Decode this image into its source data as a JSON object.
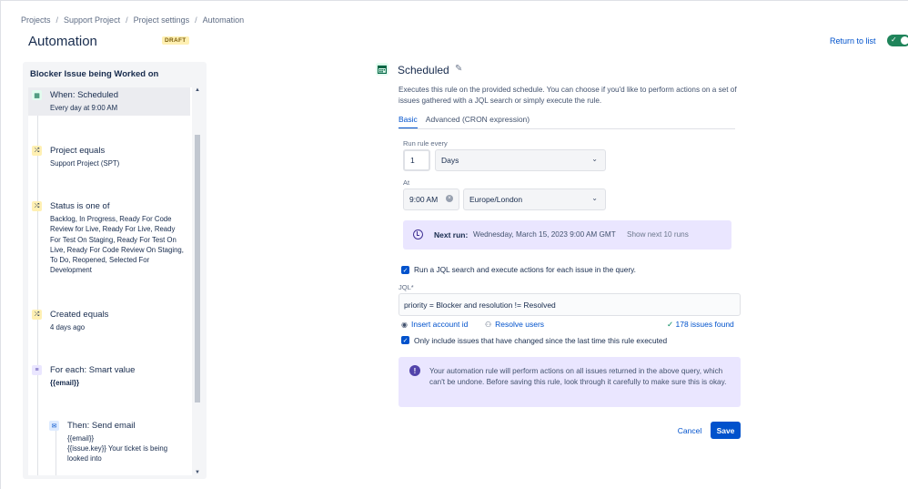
{
  "breadcrumb": {
    "items": [
      "Projects",
      "Support Project",
      "Project settings",
      "Automation"
    ]
  },
  "page": {
    "title": "Automation",
    "badge": "DRAFT",
    "return_link": "Return to list",
    "toggle_check": "✓"
  },
  "rule": {
    "name": "Blocker Issue being Worked on",
    "steps": [
      {
        "title": "When: Scheduled",
        "desc": "Every day at 9:00 AM",
        "icon": "calendar-icon"
      },
      {
        "title": "Project equals",
        "desc": "Support Project (SPT)",
        "icon": "condition-icon"
      },
      {
        "title": "Status is one of",
        "desc": "Backlog, In Progress, Ready For Code Review for Live, Ready For Live, Ready For Test On Staging, Ready For Test On Live, Ready For Code Review On Staging, To Do, Reopened, Selected For Development",
        "icon": "condition-icon"
      },
      {
        "title": "Created equals",
        "desc": "4 days ago",
        "icon": "condition-icon"
      },
      {
        "title": "For each: Smart value",
        "desc": "{{email}}",
        "icon": "branch-icon"
      },
      {
        "title": "Then: Send email",
        "desc": "{{email}}",
        "desc2": "{{issue.key}} Your ticket is being looked into",
        "icon": "email-icon"
      }
    ]
  },
  "config": {
    "title": "Scheduled",
    "description": "Executes this rule on the provided schedule. You can choose if you'd like to perform actions on a set of issues gathered with a JQL search or simply execute the rule.",
    "tabs": [
      "Basic",
      "Advanced (CRON expression)"
    ],
    "run_rule_every_label": "Run rule every",
    "interval_value": "1",
    "interval_unit": "Days",
    "at_label": "At",
    "time_value": "9:00 AM",
    "timezone": "Europe/London",
    "next_run_label": "Next run:",
    "next_run_value": "Wednesday, March 15, 2023 9:00 AM GMT",
    "show_next_runs": "Show next 10 runs",
    "jql_checkbox_label": "Run a JQL search and execute actions for each issue in the query.",
    "jql_label": "JQL",
    "jql_required": "*",
    "jql_value": "priority = Blocker and resolution != Resolved",
    "insert_account_id": "Insert account id",
    "resolve_users": "Resolve users",
    "issues_found": "178 issues found",
    "only_changed_label": "Only include issues that have changed since the last time this rule executed",
    "warning": "Your automation rule will perform actions on all issues returned in the above query, which can't be undone. Before saving this rule, look through it carefully to make sure this is okay.",
    "cancel": "Cancel",
    "save": "Save"
  },
  "colors": {
    "primary": "#0052cc",
    "success": "#1f845a",
    "discovery_bg": "#eae6ff"
  }
}
